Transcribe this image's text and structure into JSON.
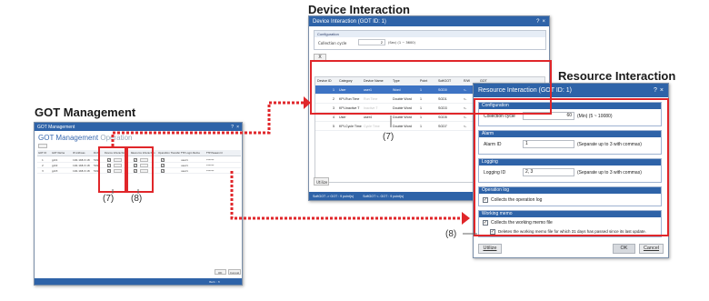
{
  "titles": {
    "got_management": "GOT Management",
    "device_interaction": "Device Interaction",
    "resource_interaction": "Resource Interaction"
  },
  "got_window": {
    "title": "GOT Management",
    "header": "GOT Management",
    "header_tab": "Operation",
    "columns": [
      "GOT ID",
      "GOT Name",
      "IP Address",
      "Port",
      "Device Interaction",
      "Resource Interaction",
      "Operation Transfer",
      "FTP Login Name",
      "FTP Password"
    ],
    "rows": [
      [
        "1",
        "got1",
        "192.168.3.18",
        "5011",
        "",
        "",
        "",
        "user1",
        "******"
      ],
      [
        "2",
        "got2",
        "192.168.3.18",
        "5011",
        "",
        "",
        "",
        "user1",
        "******"
      ],
      [
        "3",
        "got3",
        "192.168.3.18",
        "5011",
        "",
        "",
        "",
        "user1",
        "******"
      ]
    ],
    "ok_button": "OK",
    "cancel_button": "Cancel",
    "status": "Item : 3"
  },
  "device_window": {
    "title": "Device Interaction (GOT ID: 1)",
    "configuration_header": "Configuration",
    "collection_cycle_label": "Collection cycle",
    "collection_cycle_value": "2",
    "collection_cycle_unit": "(Sec)  (1 ~ 3600)",
    "delete_button": "X",
    "columns": [
      "Device ID",
      "Category",
      "Device Name",
      "Type",
      "Point",
      "SoftGOT",
      "R/W",
      "GOT"
    ],
    "rows": [
      [
        "1",
        "User",
        "user1",
        "Word",
        "1",
        "SGD0",
        "<-",
        "GD100"
      ],
      [
        "2",
        "KPI-Run Time",
        "Run Time",
        "Double Word",
        "1",
        "SGD1",
        "<-",
        "GD106"
      ],
      [
        "3",
        "KPI-Inactive T",
        "Inactive T",
        "Double Word",
        "1",
        "SGD3",
        "<-",
        "GD108"
      ],
      [
        "4",
        "User",
        "user4",
        "Double Word",
        "1",
        "SGD5",
        "<-",
        "GD140"
      ],
      [
        "5",
        "KPI-Cycle Time",
        "Cycle Time",
        "Double Word",
        "1",
        "SGD7",
        "<-",
        "GD142"
      ]
    ],
    "utilize_button": "Utilize",
    "status_left": "SoftGOT -> GOT :   9 point(s)",
    "status_right": "SoftGOT <- GOT :   9 point(s)"
  },
  "resource_window": {
    "title": "Resource Interaction (GOT ID: 1)",
    "configuration": {
      "header": "Configuration",
      "collection_cycle_label": "Collection cycle",
      "collection_cycle_value": "60",
      "collection_cycle_unit": "(Min)  (5 ~ 10080)"
    },
    "alarm": {
      "header": "Alarm",
      "label": "Alarm ID",
      "value": "1",
      "hint": "(Separate up to 3 with commas)"
    },
    "logging": {
      "header": "Logging",
      "label": "Logging ID",
      "value": "2, 3",
      "hint": "(Separate up to 3 with commas)"
    },
    "operation_log": {
      "header": "Operation log",
      "checkbox_label": "Collects the operation log",
      "checked": true
    },
    "working_memo": {
      "header": "Working memo",
      "checkbox_label": "Collects the working memo file",
      "sub_checkbox_label": "Deletes the working memo file for which 31 days has passed since its last update.",
      "checked": true,
      "sub_checked": true
    },
    "utilize_button": "Utilize",
    "ok_button": "OK",
    "cancel_button": "Cancel"
  },
  "callouts": {
    "got_device": "(7)",
    "got_resource": "(8)",
    "device": "(7)",
    "resource": "(8)"
  },
  "colors": {
    "title_bar": "#2e63a8",
    "highlight": "#e0262a",
    "selected_row": "#3d73c4"
  }
}
